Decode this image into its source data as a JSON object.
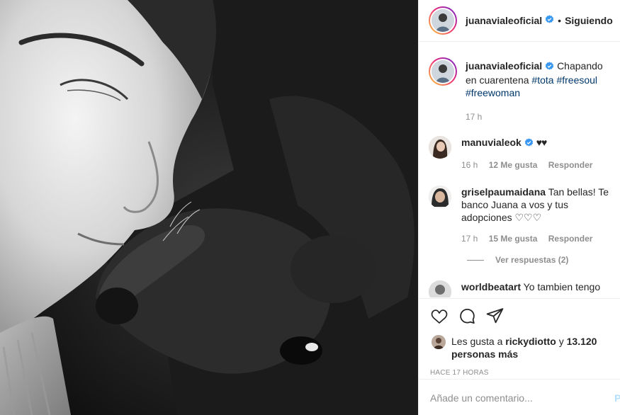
{
  "header": {
    "username": "juanavialeoficial",
    "separator": "•",
    "follow_label": "Siguiendo"
  },
  "caption": {
    "username": "juanavialeoficial",
    "text": "Chapando en cuarentena",
    "hashtags": [
      "#tota",
      "#freesoul",
      "#freewoman"
    ],
    "time": "17 h"
  },
  "comments": [
    {
      "username": "manuvialeok",
      "verified": true,
      "text": "♥♥",
      "time": "16 h",
      "likes": "12 Me gusta",
      "reply_label": "Responder"
    },
    {
      "username": "griselpaumaidana",
      "verified": false,
      "text": "Tan bellas! Te banco Juana a vos y tus adopciones ♡♡♡",
      "time": "17 h",
      "likes": "15 Me gusta",
      "reply_label": "Responder",
      "view_replies": "Ver respuestas (2)"
    },
    {
      "username": "worldbeatart",
      "verified": false,
      "text": "Yo tambien tengo"
    }
  ],
  "likes": {
    "prefix": "Les gusta a",
    "user": "rickydiotto",
    "joiner": "y",
    "count": "13.120 personas más"
  },
  "timestamp": "HACE 17 HORAS",
  "comment_input": {
    "placeholder": "Añade un comentario...",
    "post_label": "Publicar",
    "post_visible_text": "Pu"
  },
  "icons": [
    "heart-icon",
    "comment-icon",
    "share-icon",
    "verified-badge-icon"
  ],
  "colors": {
    "link": "#00376b",
    "verified": "#3897f0",
    "muted": "#8e8e8e",
    "post_disabled": "#b2dffc"
  }
}
